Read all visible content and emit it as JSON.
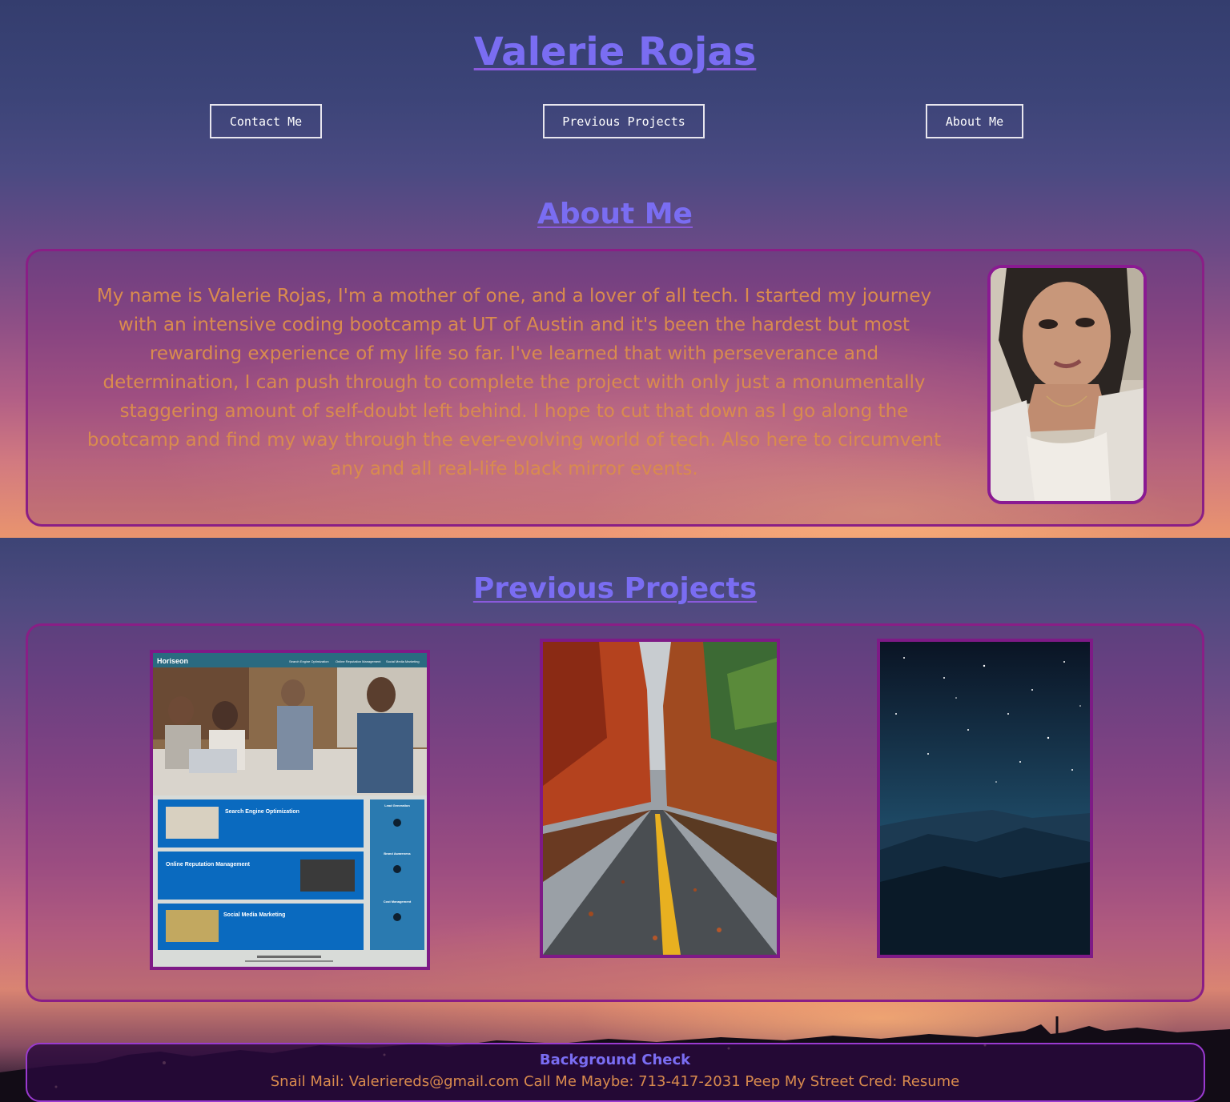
{
  "header": {
    "title": "Valerie Rojas"
  },
  "nav": {
    "items": [
      {
        "label": "Contact Me"
      },
      {
        "label": "Previous Projects"
      },
      {
        "label": "About Me"
      }
    ]
  },
  "about": {
    "heading": "About Me",
    "text": "My name is Valerie Rojas, I'm a mother of one, and a lover of all tech. I started my journey with an intensive coding bootcamp at UT of Austin and it's been the hardest but most rewarding experience of my life so far. I've learned that with perseverance and determination, I can push through to complete the project with only just a monumentally staggering amount of self-doubt left behind. I hope to cut that down as I go along the bootcamp and find my way through the ever-evolving world of tech. Also here to circumvent any and all real-life black mirror events."
  },
  "projects": {
    "heading": "Previous Projects",
    "items": [
      {
        "kind": "website-screenshot",
        "brand": "Horiseon",
        "nav": [
          "Search Engine Optimization",
          "Online Reputation Management",
          "Social Media Marketing"
        ],
        "sections": [
          "Search Engine Optimization",
          "Online Reputation Management",
          "Social Media Marketing"
        ],
        "sidebar": [
          "Lead Generation",
          "Brand Awareness",
          "Cost Management"
        ]
      },
      {
        "kind": "autumn-road-photo"
      },
      {
        "kind": "starry-mountain-photo"
      }
    ]
  },
  "footer": {
    "title": "Background Check",
    "mail_label": "Snail Mail:",
    "mail_value": "Valeriereds@gmail.com",
    "phone_label": "Call Me Maybe:",
    "phone_value": "713-417-2031",
    "cred_label": "Peep My Street Cred:",
    "cred_value": "Resume"
  },
  "colors": {
    "accent": "#7a6df2",
    "text": "#d98b4e",
    "card_border": "#8a1e86"
  }
}
